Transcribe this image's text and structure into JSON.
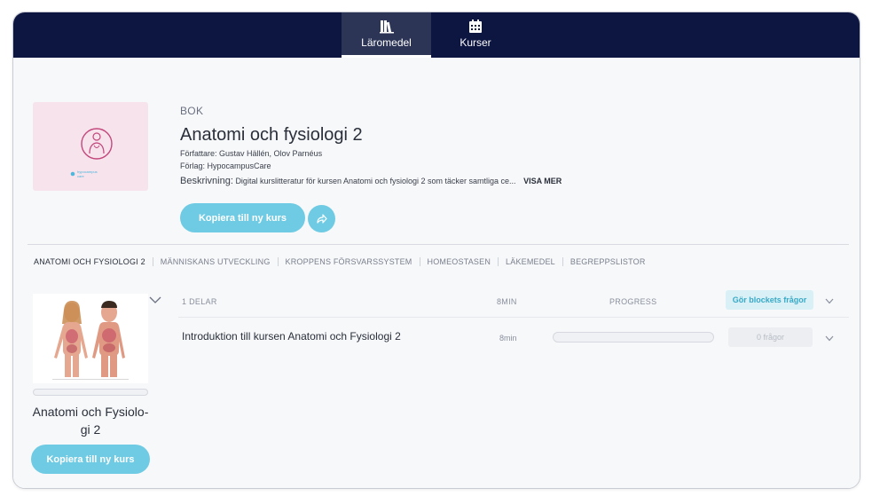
{
  "nav": {
    "tabs": [
      {
        "label": "Läromedel",
        "icon": "books-icon",
        "active": true
      },
      {
        "label": "Kurser",
        "icon": "calendar-icon",
        "active": false
      }
    ]
  },
  "book": {
    "type": "BOK",
    "title": "Anatomi och fysiologi 2",
    "authors": "Författare: Gustav Hällén, Olov Parnéus",
    "publisher": "Förlag: HypocampusCare",
    "description_label": "Beskrivning:",
    "description": "Digital kurslitteratur för kursen Anatomi och fysiologi 2 som täcker samtliga ce...",
    "show_more": "VISA MER",
    "copy_button": "Kopiera till ny kurs",
    "cover_logo_text": "hypocampus care"
  },
  "chapters": [
    "ANATOMI OCH FYSIOLOGI 2",
    "MÄNNISKANS UTVECKLING",
    "KROPPENS FÖRSVARSSYSTEM",
    "HOMEOSTASEN",
    "LÄKEMEDEL",
    "BEGREPPSLISTOR"
  ],
  "selected_chapter": {
    "title": "Anatomi och Fysiolo-gi 2",
    "copy_button": "Kopiera till ny kurs"
  },
  "lesson_list": {
    "parts": "1 DELAR",
    "minutes": "8MIN",
    "progress_header": "PROGRESS",
    "block_questions_button": "Gör blockets frågor",
    "lessons": [
      {
        "title": "Introduktion till kursen Anatomi och Fysiologi 2",
        "minutes": "8min",
        "progress": 0,
        "questions": "0 frågor"
      }
    ]
  },
  "colors": {
    "nav_bg": "#0d1541",
    "accent": "#6fcbe3",
    "cover_bg": "#f7e3ec"
  }
}
